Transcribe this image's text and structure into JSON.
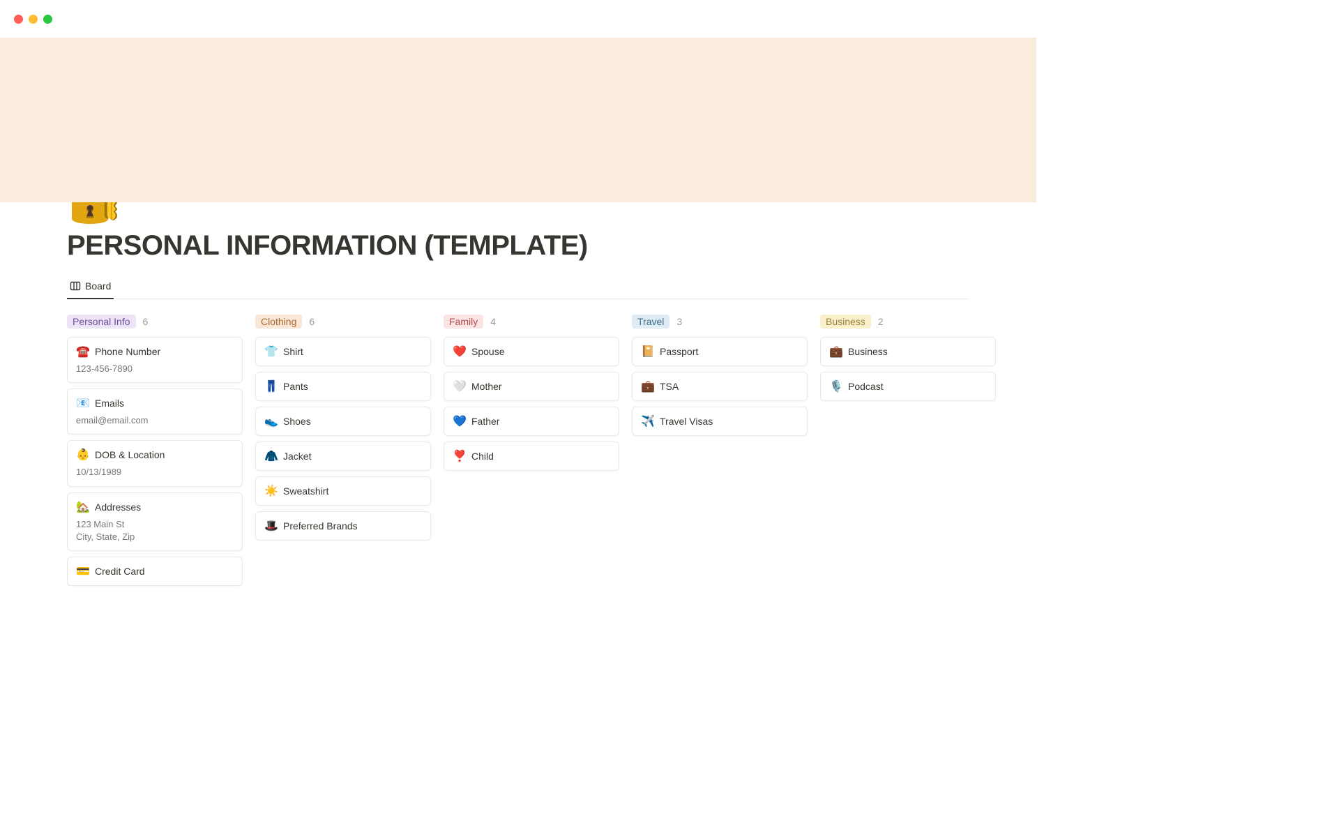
{
  "page": {
    "icon": "🔐",
    "title": "PERSONAL INFORMATION (TEMPLATE)"
  },
  "tabs": {
    "board": "Board"
  },
  "columns": [
    {
      "label": "Personal Info",
      "tagClass": "tag-purple",
      "count": "6",
      "cards": [
        {
          "emoji": "☎️",
          "title": "Phone Number",
          "sub": "123-456-7890"
        },
        {
          "emoji": "📧",
          "title": "Emails",
          "sub": "email@email.com"
        },
        {
          "emoji": "👶",
          "title": "DOB & Location",
          "sub": "10/13/1989"
        },
        {
          "emoji": "🏡",
          "title": "Addresses",
          "sub": "123 Main St\nCity, State, Zip"
        },
        {
          "emoji": "💳",
          "title": "Credit Card"
        }
      ]
    },
    {
      "label": "Clothing",
      "tagClass": "tag-orange",
      "count": "6",
      "cards": [
        {
          "emoji": "👕",
          "title": "Shirt"
        },
        {
          "emoji": "👖",
          "title": "Pants"
        },
        {
          "emoji": "👟",
          "title": "Shoes"
        },
        {
          "emoji": "🧥",
          "title": "Jacket"
        },
        {
          "emoji": "☀️",
          "title": "Sweatshirt"
        },
        {
          "emoji": "🎩",
          "title": "Preferred Brands"
        }
      ]
    },
    {
      "label": "Family",
      "tagClass": "tag-red",
      "count": "4",
      "cards": [
        {
          "emoji": "❤️",
          "title": "Spouse"
        },
        {
          "emoji": "🤍",
          "title": "Mother"
        },
        {
          "emoji": "💙",
          "title": "Father"
        },
        {
          "emoji": "❣️",
          "title": "Child"
        }
      ]
    },
    {
      "label": "Travel",
      "tagClass": "tag-blue",
      "count": "3",
      "cards": [
        {
          "emoji": "📔",
          "title": "Passport"
        },
        {
          "emoji": "💼",
          "title": "TSA"
        },
        {
          "emoji": "✈️",
          "title": "Travel Visas"
        }
      ]
    },
    {
      "label": "Business",
      "tagClass": "tag-yellow",
      "count": "2",
      "cards": [
        {
          "emoji": "💼",
          "title": "Business"
        },
        {
          "emoji": "🎙️",
          "title": "Podcast"
        }
      ]
    }
  ]
}
